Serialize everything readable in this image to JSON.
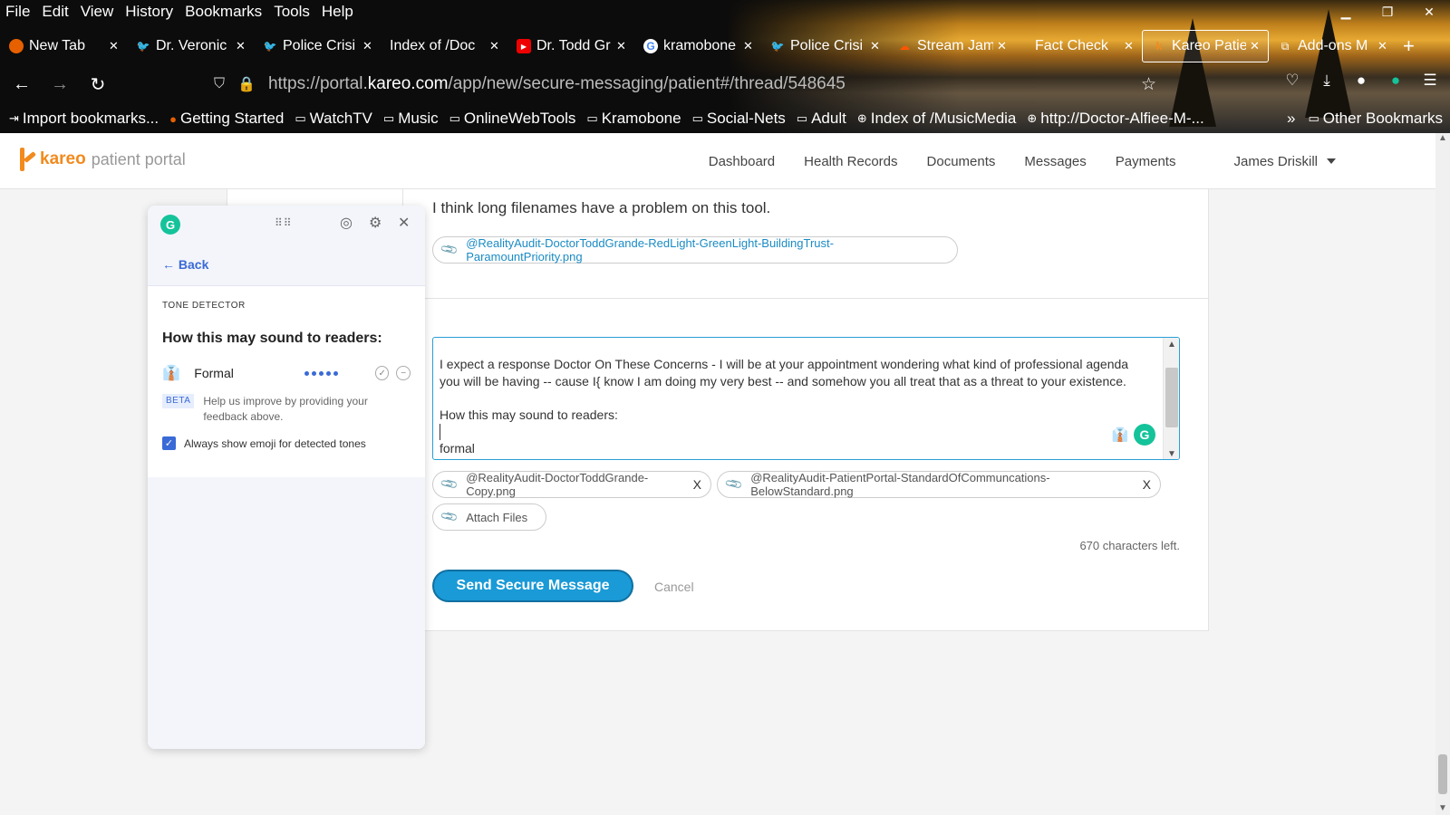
{
  "browser": {
    "menu": [
      "File",
      "Edit",
      "View",
      "History",
      "Bookmarks",
      "Tools",
      "Help"
    ],
    "tabs": [
      {
        "label": "New Tab",
        "icon": "firefox-icon"
      },
      {
        "label": "Dr. Veronic",
        "icon": "twitter-icon"
      },
      {
        "label": "Police Crisi",
        "icon": "twitter-icon"
      },
      {
        "label": "Index of /Doc",
        "icon": ""
      },
      {
        "label": "Dr. Todd Gr",
        "icon": "youtube-icon"
      },
      {
        "label": "kramobone",
        "icon": "google-icon"
      },
      {
        "label": "Police Crisi",
        "icon": "twitter-icon"
      },
      {
        "label": "Stream Jam",
        "icon": "soundcloud-icon"
      },
      {
        "label": "Fact Check",
        "icon": ""
      },
      {
        "label": "Kareo Patie",
        "icon": "kareo-icon",
        "active": true
      },
      {
        "label": "Add-ons M",
        "icon": "puzzle-icon"
      }
    ],
    "url": {
      "prefix": "https://portal.",
      "domain": "kareo.com",
      "path": "/app/new/secure-messaging/patient#/thread/548645"
    },
    "bookmarks": [
      {
        "label": "Import bookmarks...",
        "icon": "import-icon"
      },
      {
        "label": "Getting Started",
        "icon": "firefox-icon"
      },
      {
        "label": "WatchTV",
        "icon": "folder-icon"
      },
      {
        "label": "Music",
        "icon": "folder-icon"
      },
      {
        "label": "OnlineWebTools",
        "icon": "folder-icon"
      },
      {
        "label": "Kramobone",
        "icon": "folder-icon"
      },
      {
        "label": "Social-Nets",
        "icon": "folder-icon"
      },
      {
        "label": "Adult",
        "icon": "folder-icon"
      },
      {
        "label": "Index of /MusicMedia",
        "icon": "globe-icon"
      },
      {
        "label": "http://Doctor-Alfiee-M-...",
        "icon": "globe-icon"
      }
    ],
    "other_bookmarks": "Other Bookmarks"
  },
  "site": {
    "brand": "kareo",
    "brand_sub": "patient portal",
    "nav": [
      "Dashboard",
      "Health Records",
      "Documents",
      "Messages",
      "Payments"
    ],
    "user": "James Driskill"
  },
  "thread": {
    "previous_message": "I think long filenames have a problem on this tool.",
    "previous_attachment": "@RealityAudit-DoctorToddGrande-RedLight-GreenLight-BuildingTrust-ParamountPriority.png"
  },
  "composer": {
    "line1": "I expect a response Doctor On These Concerns - I will be at your appointment wondering what kind of professional agenda",
    "line2": "you will be having -- cause I{ know I am doing my very best -- and somehow you all treat that as a threat to your existence.",
    "line3": "How this may sound to readers:",
    "line4": "formal",
    "attachments": [
      "@RealityAudit-DoctorToddGrande-Copy.png",
      "@RealityAudit-PatientPortal-StandardOfCommuncations-BelowStandard.png"
    ],
    "remove_label": "X",
    "attach_label": "Attach Files",
    "chars_left": "670 characters left.",
    "send_label": "Send Secure Message",
    "cancel_label": "Cancel"
  },
  "grammarly": {
    "back_label": "Back",
    "section": "TONE DETECTOR",
    "heading": "How this may sound to readers:",
    "tone": "Formal",
    "tone_level": 5,
    "beta_tag": "BETA",
    "beta_text": "Help us improve by providing your feedback above.",
    "checkbox_label": "Always show emoji for detected tones",
    "checkbox_checked": true,
    "accent": "#3a6ad6",
    "brand_color": "#15c39a"
  }
}
